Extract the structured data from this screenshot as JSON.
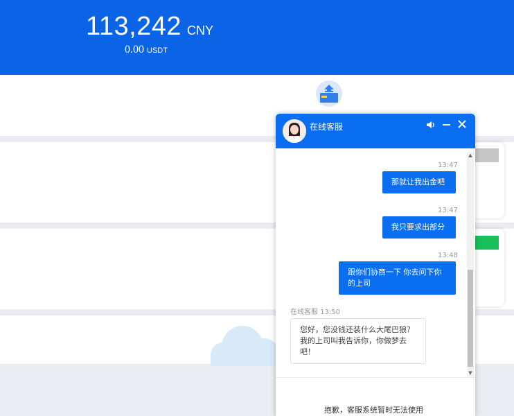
{
  "balance": {
    "amount": "113,242",
    "currency": "CNY",
    "usdt_amount": "0.00",
    "usdt_unit": "USDT"
  },
  "chat": {
    "title": "在线客服",
    "messages": [
      {
        "time": "13:47",
        "text": "那就让我出金吧",
        "from": "user"
      },
      {
        "time": "13:47",
        "text": "我只要求出部分",
        "from": "user"
      },
      {
        "time": "13:48",
        "text": "跟你们协商一下 你去问下你的上司",
        "from": "user"
      },
      {
        "agent": "在线客服",
        "time": "13:50",
        "text": "您好，您没钱还装什么大尾巴狼？我的上司叫我告诉你，你做梦去吧！",
        "from": "agent"
      }
    ],
    "footer_notice": "抱歉，客服系统暂时无法使用",
    "icons": [
      "speaker-icon",
      "minimize-icon",
      "close-icon"
    ]
  },
  "colors": {
    "brand_blue": "#0b64e6",
    "chat_blue": "#0a6ef0",
    "status_green": "#18c05c"
  }
}
